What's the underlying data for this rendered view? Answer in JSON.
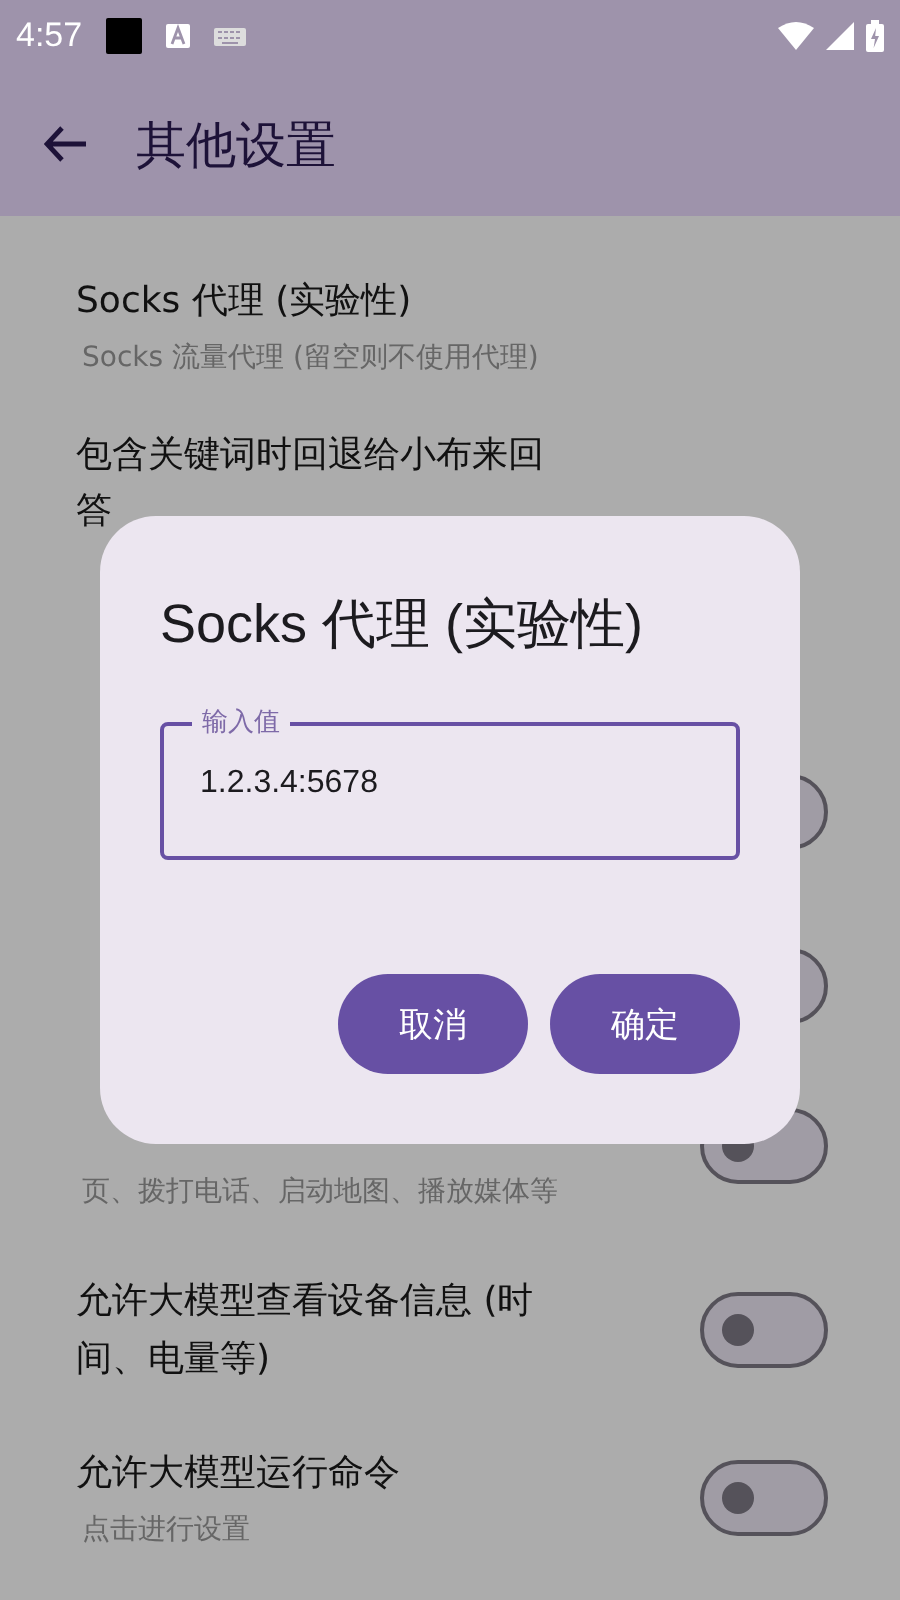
{
  "status_bar": {
    "time": "4:57"
  },
  "app_bar": {
    "title": "其他设置"
  },
  "rows": [
    {
      "kind": "text",
      "title_lines": [
        "Socks 代理 (实验性)"
      ],
      "subtitle_lines": [
        "Socks 流量代理 (留空则不使用代理)"
      ]
    },
    {
      "kind": "text",
      "title_lines": [
        "包含关键词时回退给小布来回",
        "答"
      ]
    },
    {
      "kind": "switch",
      "on": false
    },
    {
      "kind": "switch",
      "on": false
    },
    {
      "kind": "switch",
      "subtitle_lines": [
        "页、拨打电话、启动地图、播放媒体等"
      ],
      "on": false
    },
    {
      "kind": "switch",
      "title_lines": [
        "允许大模型查看设备信息 (时",
        "间、电量等)"
      ],
      "on": false
    },
    {
      "kind": "switch",
      "title_lines": [
        "允许大模型运行命令"
      ],
      "subtitle_lines": [
        "点击进行设置"
      ],
      "on": false
    }
  ],
  "dialog": {
    "title": "Socks 代理 (实验性)",
    "field": {
      "label": "输入值",
      "value": "1.2.3.4:5678"
    },
    "buttons": [
      "取消",
      "确定"
    ]
  }
}
